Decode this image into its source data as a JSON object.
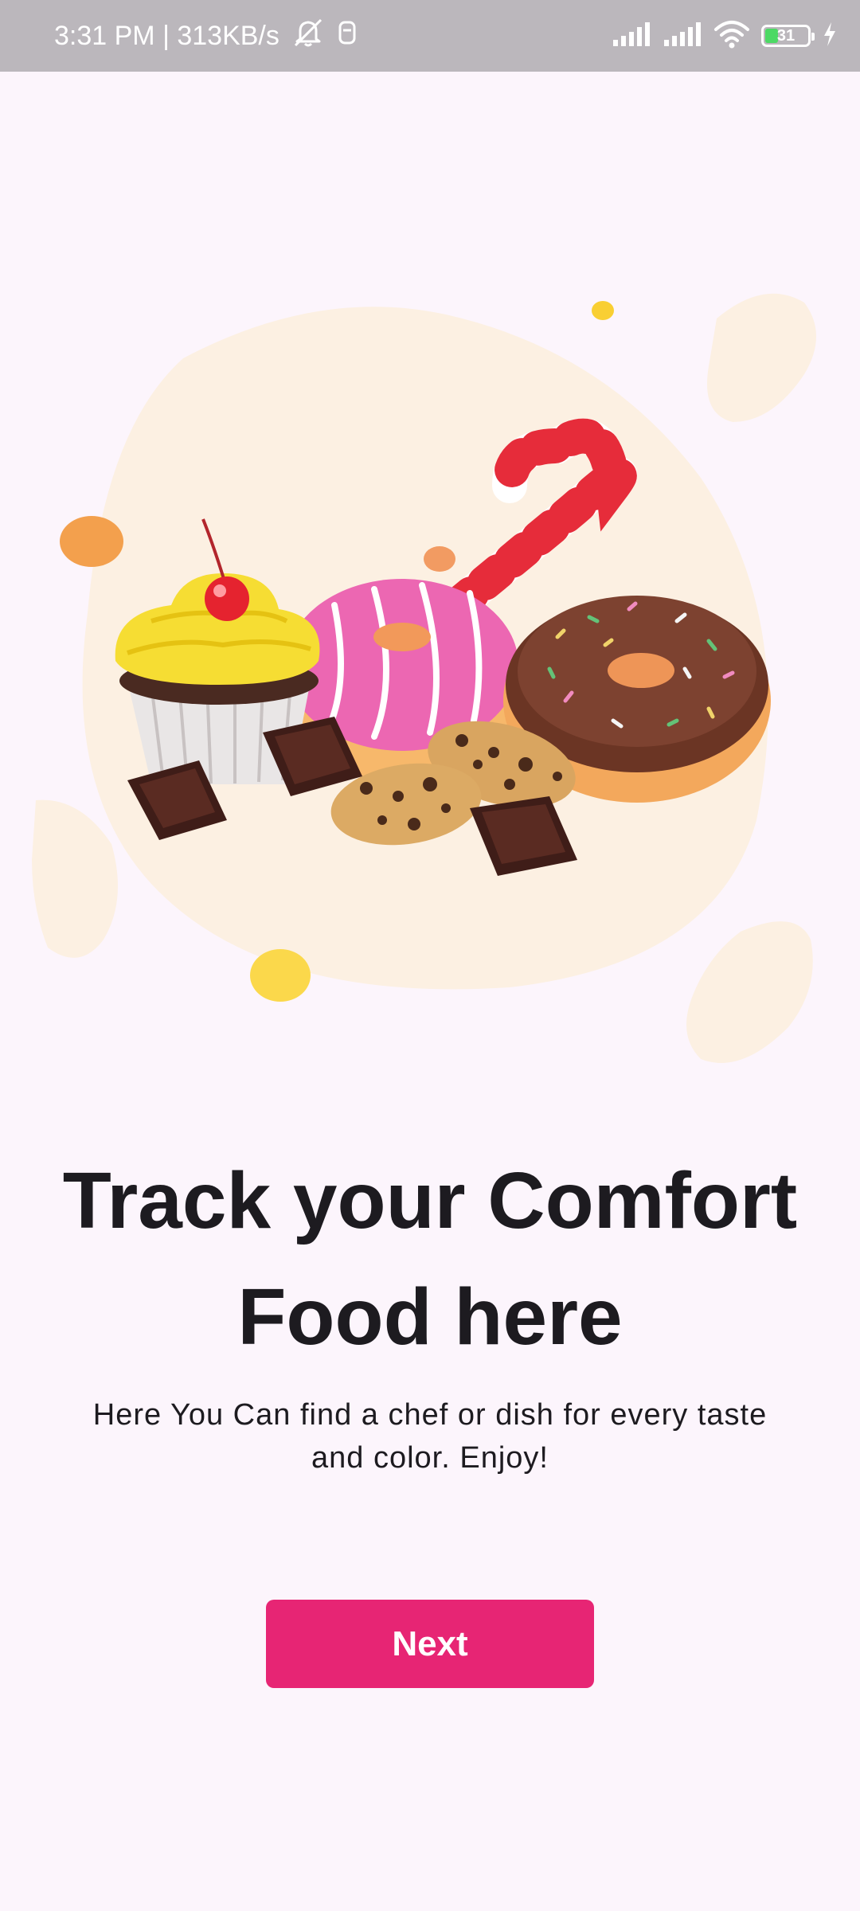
{
  "status_bar": {
    "time_speed": "3:31 PM | 313KB/s",
    "battery_level": "31",
    "icons": [
      "mute-icon",
      "sim-icon",
      "signal-icon",
      "signal-icon",
      "wifi-icon",
      "battery-icon",
      "charging-icon"
    ]
  },
  "onboarding": {
    "illustration": "sweets-illustration",
    "title": "Track your  Comfort Food here",
    "description": "Here You Can find a chef or dish for every taste and color. Enjoy!",
    "next_label": "Next"
  },
  "colors": {
    "background": "#fcf5fc",
    "status_bar": "#bbb7bc",
    "accent": "#e72574",
    "text": "#1d1b20"
  }
}
